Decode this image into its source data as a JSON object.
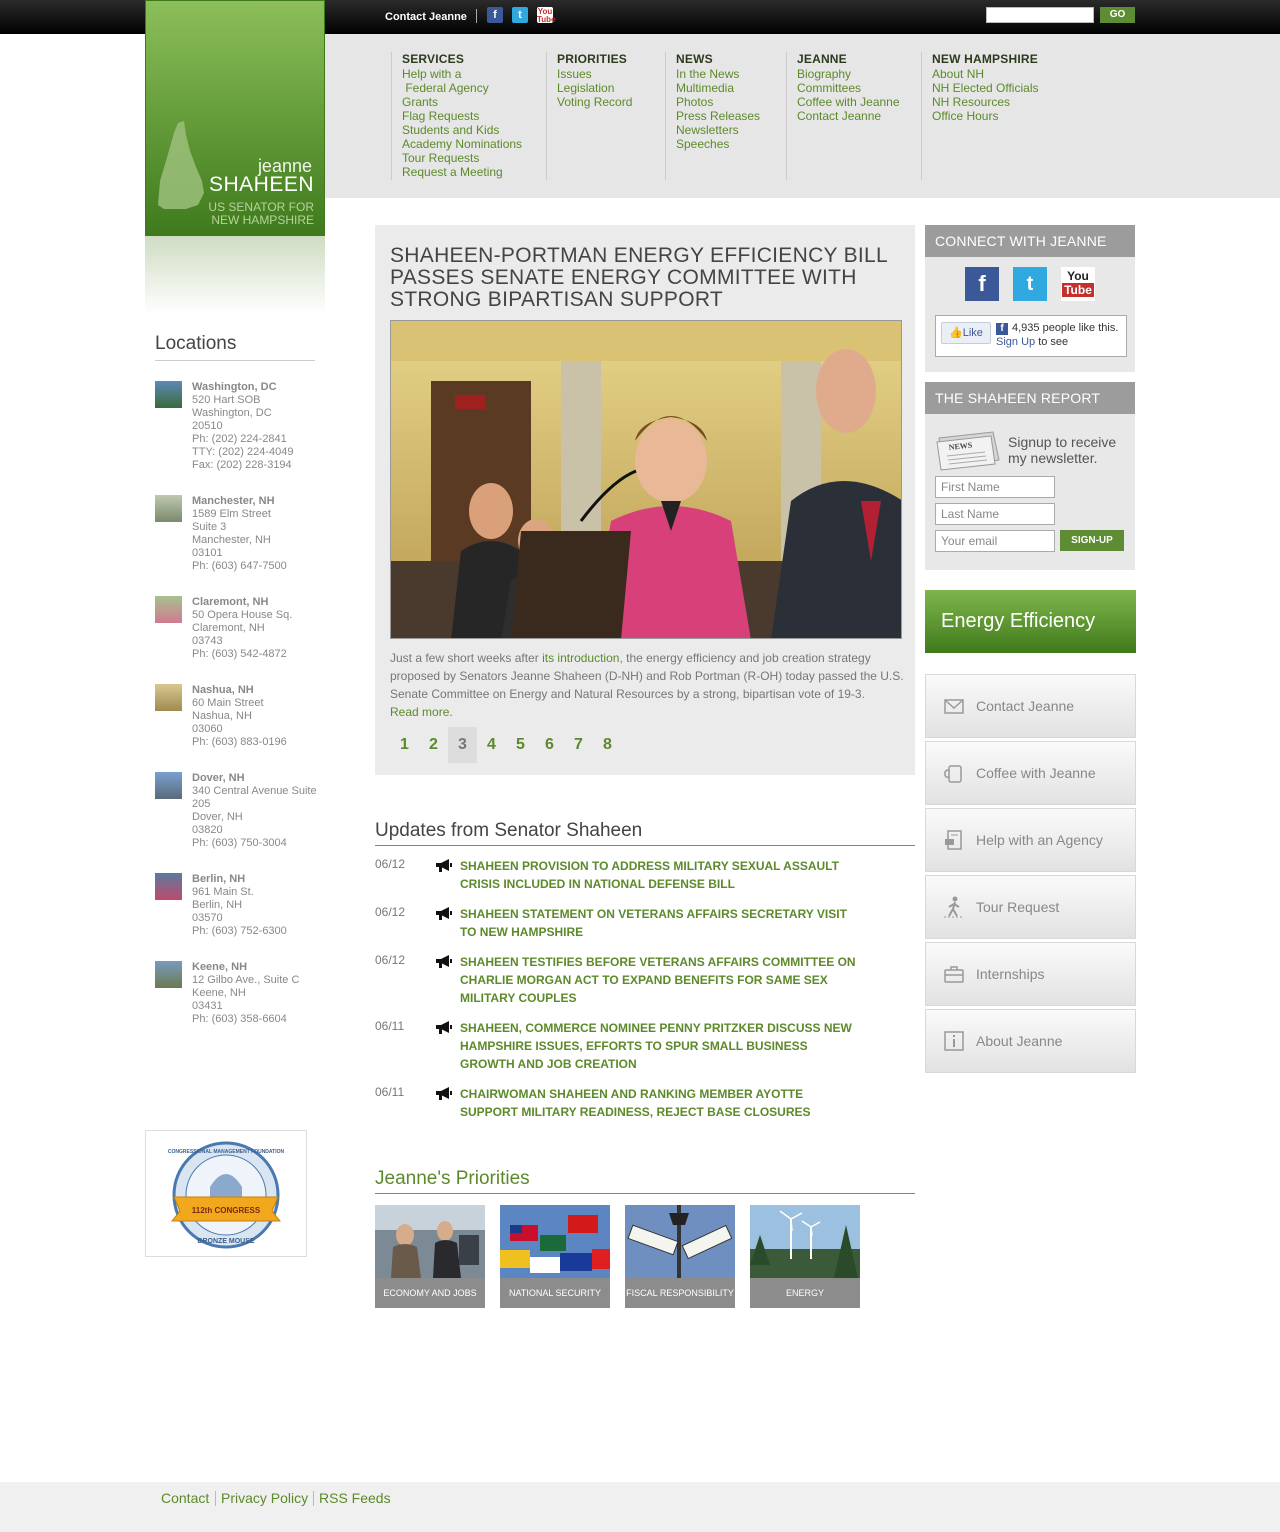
{
  "topbar": {
    "contact_label": "Contact Jeanne",
    "search": {
      "value": "",
      "placeholder": ""
    },
    "go_label": "GO"
  },
  "logo": {
    "first": "jeanne",
    "last": "SHAHEEN",
    "line1": "US SENATOR FOR",
    "line2": "NEW HAMPSHIRE"
  },
  "nav": {
    "services": {
      "title": "SERVICES",
      "items": [
        "Help with a\n Federal Agency",
        "Grants",
        "Flag Requests",
        "Students and Kids",
        "Academy Nominations",
        "Tour Requests",
        "Request a Meeting"
      ]
    },
    "priorities": {
      "title": "PRIORITIES",
      "items": [
        "Issues",
        "Legislation",
        "Voting Record"
      ]
    },
    "news": {
      "title": "NEWS",
      "items": [
        "In the News",
        "Multimedia",
        "Photos",
        "Press Releases",
        "Newsletters",
        "Speeches"
      ]
    },
    "jeanne": {
      "title": "JEANNE",
      "items": [
        "Biography",
        "Committees",
        "Coffee with Jeanne",
        "Contact Jeanne"
      ]
    },
    "nh": {
      "title": "NEW HAMPSHIRE",
      "items": [
        "About NH",
        "NH Elected Officials",
        "NH Resources",
        "Office Hours"
      ]
    }
  },
  "locations": {
    "title": "Locations",
    "items": [
      {
        "name": "Washington, DC",
        "lines": [
          "520 Hart SOB",
          "Washington, DC",
          "20510",
          "Ph: (202) 224-2841",
          "TTY: (202) 224-4049",
          "Fax: (202) 228-3194"
        ]
      },
      {
        "name": "Manchester, NH",
        "lines": [
          "1589 Elm Street",
          "Suite 3",
          "Manchester, NH",
          "03101",
          "Ph: (603) 647-7500"
        ]
      },
      {
        "name": "Claremont, NH",
        "lines": [
          "50 Opera House Sq.",
          "Claremont, NH",
          "03743",
          "Ph: (603) 542-4872"
        ]
      },
      {
        "name": "Nashua, NH",
        "lines": [
          "60 Main Street",
          "Nashua, NH",
          "03060",
          "Ph: (603) 883-0196"
        ]
      },
      {
        "name": "Dover, NH",
        "lines": [
          "340 Central Avenue Suite",
          "205",
          "Dover, NH",
          "03820",
          "Ph: (603) 750-3004"
        ]
      },
      {
        "name": "Berlin, NH",
        "lines": [
          "961 Main St.",
          "Berlin, NH",
          "03570",
          "Ph: (603) 752-6300"
        ]
      },
      {
        "name": "Keene, NH",
        "lines": [
          "12 Gilbo Ave., Suite C",
          "Keene, NH",
          "03431",
          "Ph: (603) 358-6604"
        ]
      }
    ]
  },
  "badge": {
    "top": "CONGRESSIONAL MANAGEMENT FOUNDATION",
    "ribbon": "112th CONGRESS",
    "bottom": "BRONZE MOUSE"
  },
  "feature": {
    "title": "Shaheen-Portman Energy Efficiency Bill Passes Senate Energy Committee with Strong Bipartisan Support",
    "summary_pre": "Just a few short weeks after ",
    "summary_link": "its introduction",
    "summary_post": ", the energy efficiency and job creation strategy proposed by Senators Jeanne Shaheen (D-NH) and Rob Portman (R-OH) today passed the U.S. Senate Committee on Energy and Natural Resources by a strong, bipartisan vote of 19-3.",
    "read_more": "Read more.",
    "pages": [
      "1",
      "2",
      "3",
      "4",
      "5",
      "6",
      "7",
      "8"
    ],
    "active_page": 3
  },
  "updates": {
    "title": "Updates from Senator Shaheen",
    "items": [
      {
        "date": "06/12",
        "title": "Shaheen Provision to Address Military Sexual Assault Crisis Included in National Defense Bill"
      },
      {
        "date": "06/12",
        "title": "Shaheen Statement on Veterans Affairs Secretary Visit to New Hampshire"
      },
      {
        "date": "06/12",
        "title": "Shaheen Testifies Before Veterans Affairs Committee on Charlie Morgan Act to Expand Benefits for Same Sex Military Couples"
      },
      {
        "date": "06/11",
        "title": "Shaheen, Commerce Nominee Penny Pritzker Discuss New Hampshire Issues, Efforts to Spur Small Business Growth and Job Creation"
      },
      {
        "date": "06/11",
        "title": "Chairwoman Shaheen and Ranking Member Ayotte Support Military Readiness, Reject Base Closures"
      }
    ]
  },
  "priorities": {
    "title": "Jeanne's Priorities",
    "items": [
      "Economy and Jobs",
      "National Security",
      "Fiscal Responsibility",
      "Energy"
    ]
  },
  "connect": {
    "title": "CONNECT WITH JEANNE",
    "like_label": "Like",
    "like_text_pre": "4,935 people like this.",
    "signup_link": "Sign Up",
    "like_text_post": "to see"
  },
  "report": {
    "title": "THE SHAHEEN REPORT",
    "intro": "Signup to receive my newsletter.",
    "first_ph": "First Name",
    "last_ph": "Last Name",
    "email_ph": "Your email",
    "signup_label": "SIGN-UP"
  },
  "energy_banner": "Energy Efficiency",
  "quick_links": [
    "Contact Jeanne",
    "Coffee with Jeanne",
    "Help with an Agency",
    "Tour Request",
    "Internships",
    "About Jeanne"
  ],
  "footer": {
    "links": [
      "Contact",
      "Privacy Policy",
      "RSS Feeds"
    ]
  },
  "colors": {
    "accent_green": "#5c8a2a",
    "topbar": "#000000",
    "nav_bg": "#e6e6e6"
  }
}
